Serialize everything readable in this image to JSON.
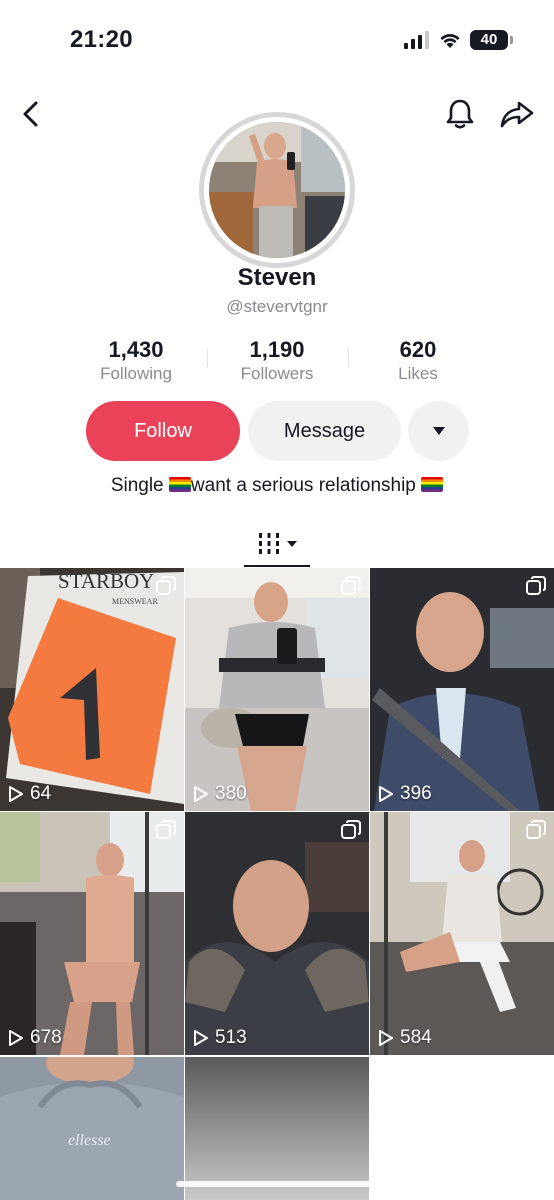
{
  "status_bar": {
    "time": "21:20",
    "battery_level": "40"
  },
  "nav": {
    "back_icon": "chevron-left-icon",
    "bell_icon": "bell-icon",
    "share_icon": "share-arrow-icon"
  },
  "profile": {
    "name": "Steven",
    "handle": "@stevervtgnr",
    "avatar_icon": "profile-photo"
  },
  "stats": [
    {
      "value": "1,430",
      "label": "Following"
    },
    {
      "value": "1,190",
      "label": "Followers"
    },
    {
      "value": "620",
      "label": "Likes"
    }
  ],
  "actions": {
    "follow_label": "Follow",
    "message_label": "Message",
    "more_icon": "caret-down-icon"
  },
  "bio": {
    "part1": "Single ",
    "part2": "want a serious relationship "
  },
  "tabs": {
    "videos_icon": "grid-bars-icon"
  },
  "videos": [
    {
      "views": "64",
      "multi": true
    },
    {
      "views": "380",
      "multi": true
    },
    {
      "views": "396",
      "multi": true
    },
    {
      "views": "678",
      "multi": true
    },
    {
      "views": "513",
      "multi": true
    },
    {
      "views": "584",
      "multi": true
    },
    {
      "views": "",
      "multi": false
    },
    {
      "views": "",
      "multi": false
    }
  ],
  "thumb_text": {
    "brand": "STARBOY",
    "sub": "MENSWEAR",
    "hoodie": "ellesse"
  },
  "colors": {
    "follow": "#ea4359",
    "secondary_button": "#f1f1f2",
    "muted_text": "#8a8b91"
  }
}
